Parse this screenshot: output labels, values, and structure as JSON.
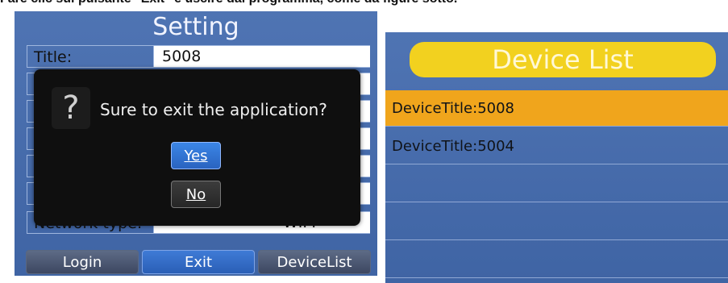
{
  "caption": "Fare clic sul pulsante \"Exit\" e uscire dal programma, come da figure sotto.",
  "setting_screen": {
    "title": "Setting",
    "fields": [
      {
        "label": "Title:",
        "value": "5008"
      },
      {
        "label": "",
        "value": ""
      },
      {
        "label": "",
        "value": ""
      },
      {
        "label": "",
        "value": ""
      },
      {
        "label": "",
        "value": ""
      },
      {
        "label": "",
        "value": ""
      },
      {
        "label": "Network type:",
        "value": "WIFI"
      }
    ],
    "buttons": {
      "login": "Login",
      "exit": "Exit",
      "device_list": "DeviceList"
    }
  },
  "dialog": {
    "icon": "question-icon",
    "message": "Sure to exit the application?",
    "yes": "Yes",
    "no": "No"
  },
  "device_list_screen": {
    "title": "Device List",
    "items": [
      {
        "text": "DeviceTitle:5008",
        "selected": true
      },
      {
        "text": "DeviceTitle:5004",
        "selected": false
      },
      {
        "text": "",
        "selected": false
      },
      {
        "text": "",
        "selected": false
      },
      {
        "text": "",
        "selected": false
      }
    ]
  },
  "colors": {
    "screen_blue": "#4f74b3",
    "selected_orange": "#f0a51c",
    "header_yellow": "#f2d11f"
  }
}
